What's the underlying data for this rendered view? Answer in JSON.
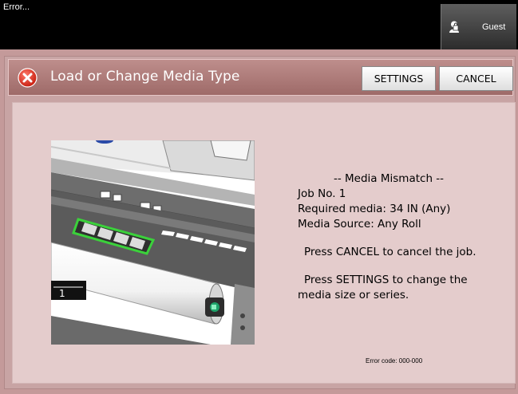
{
  "window": {
    "title": "Error..."
  },
  "user": {
    "label": "Guest",
    "icon": "user-lock-icon"
  },
  "dialog": {
    "title": "Load or Change Media Type",
    "status_icon": "error-x-icon",
    "buttons": {
      "settings": "SETTINGS",
      "cancel": "CANCEL"
    }
  },
  "message": {
    "heading": "-- Media Mismatch --",
    "job_line": "Job No.  1",
    "required_media": "Required media:   34 IN (Any)",
    "media_source": "Media Source:  Any Roll",
    "cancel_instruction": "Press CANCEL to cancel the job.",
    "settings_instruction_1": "Press SETTINGS to change the",
    "settings_instruction_2": "media size or series."
  },
  "illustration": {
    "roll_label": "1"
  },
  "footer": {
    "error_code": "Error code:  000-000"
  },
  "colors": {
    "header": "#a87472",
    "panel": "#e4cccc",
    "error_icon": "#e0301e",
    "highlight": "#33cc33"
  }
}
